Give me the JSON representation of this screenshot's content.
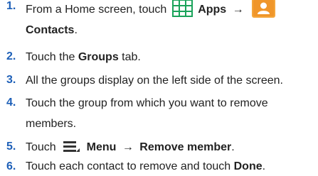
{
  "steps": [
    {
      "number": "1.",
      "line1_pre": "From a Home screen, touch",
      "apps_label": "Apps",
      "arrow": "→",
      "contacts_label": "Contacts",
      "trailing": "."
    },
    {
      "number": "2.",
      "pre": "Touch the ",
      "bold": "Groups",
      "post": " tab."
    },
    {
      "number": "3.",
      "text": "All the groups display on the left side of the screen."
    },
    {
      "number": "4.",
      "line1": "Touch the group from which you want to remove",
      "line2": "members."
    },
    {
      "number": "5.",
      "pre": "Touch",
      "menu_label": "Menu",
      "arrow": "→",
      "action": "Remove member",
      "trailing": "."
    },
    {
      "number": "6.",
      "pre": "Touch each contact to remove and touch ",
      "bold": "Done",
      "post": "."
    }
  ],
  "colors": {
    "number": "#1e60b8",
    "apps_icon": "#1aa35a",
    "contacts_icon": "#f0962a"
  },
  "icons": {
    "apps": "apps-grid-icon",
    "contacts": "contacts-icon",
    "menu": "menu-icon"
  }
}
